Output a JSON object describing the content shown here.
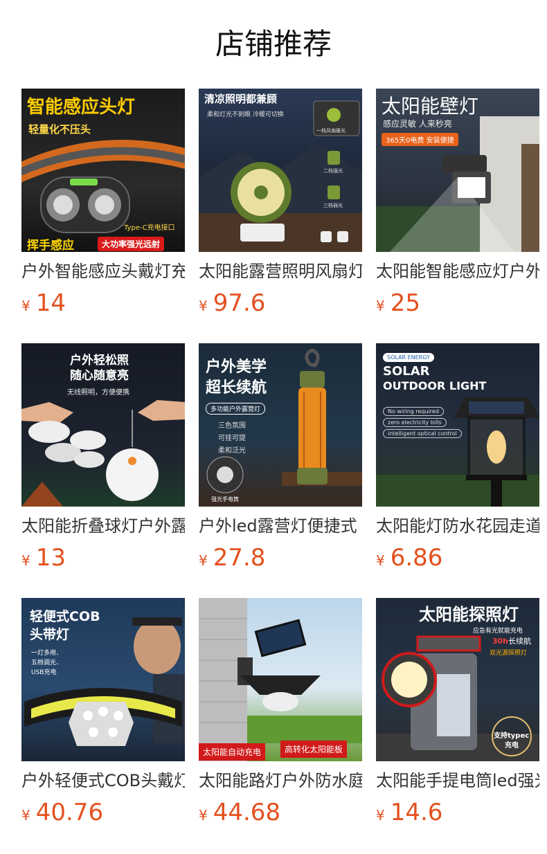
{
  "page": {
    "title": "店铺推荐"
  },
  "colors": {
    "price": "#e4501e",
    "title": "#111111",
    "name": "#333333"
  },
  "products": [
    {
      "name": "户外智能感应头戴灯充电",
      "currency": "¥",
      "price": "14",
      "thumb": {
        "headline": "智能感应头灯",
        "sub": "轻量化不压头",
        "note": "Type-C充电接口",
        "badge1": "挥手感应",
        "badge2": "大功率强光远射"
      }
    },
    {
      "name": "太阳能露营照明风扇灯",
      "currency": "¥",
      "price": "97.6",
      "thumb": {
        "headline": "清凉照明都兼顾",
        "sub": "柔和灯光不刺眼 冷暖可切换",
        "m1": "一档风扇暖光",
        "m2": "二档强光",
        "m3": "三档弱光"
      }
    },
    {
      "name": "太阳能智能感应灯户外",
      "currency": "¥",
      "price": "25",
      "thumb": {
        "headline": "太阳能壁灯",
        "sub": "感应灵敏 人来秒亮",
        "badge": "365天0电费 安装便捷"
      }
    },
    {
      "name": "太阳能折叠球灯户外露营",
      "currency": "¥",
      "price": "13",
      "thumb": {
        "headline1": "户外轻松照",
        "headline2": "随心随意亮",
        "sub": "无线照明，方便便携"
      }
    },
    {
      "name": "户外led露营灯便捷式",
      "currency": "¥",
      "price": "27.8",
      "thumb": {
        "headline1": "户外美学",
        "headline2": "超长续航",
        "badge": "多功能户外露营灯",
        "f1": "三色氛围",
        "f2": "可挂可提",
        "f3": "柔和泛光",
        "note": "强光手电筒"
      }
    },
    {
      "name": "太阳能灯防水花园走道",
      "currency": "¥",
      "price": "6.86",
      "thumb": {
        "badge": "SOLAR ENERGY",
        "headline1": "SOLAR",
        "headline2": "OUTDOOR LIGHT",
        "p1": "No wiring required",
        "p2": "zero electricity bills",
        "p3": "intelligent optical control"
      }
    },
    {
      "name": "户外轻便式COB头戴灯",
      "currency": "¥",
      "price": "40.76",
      "thumb": {
        "headline1": "轻便式COB",
        "headline2": "头带灯",
        "f1": "一灯多用、",
        "f2": "五档调光、",
        "f3": "USB充电"
      }
    },
    {
      "name": "太阳能路灯户外防水庭院",
      "currency": "¥",
      "price": "44.68",
      "thumb": {
        "badge1": "太阳能自动充电",
        "badge2": "高转化太阳能板"
      }
    },
    {
      "name": "太阳能手提电筒led强光",
      "currency": "¥",
      "price": "14.6",
      "thumb": {
        "headline": "太阳能探照灯",
        "sub1": "应急有光就能充电",
        "sub2a": "30h",
        "sub2b": "长续航",
        "sub3": "双光源探照灯",
        "note1": "支持typec",
        "note2": "充电"
      }
    }
  ]
}
